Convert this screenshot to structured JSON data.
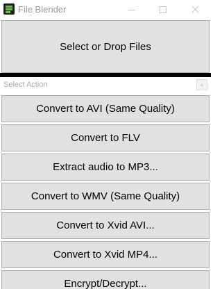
{
  "window": {
    "title": "File Blender",
    "icon": "file-blender-app-icon"
  },
  "drop_zone": {
    "label": "Select or Drop Files"
  },
  "section": {
    "title": "Select Action",
    "collapse_icon": "double-chevron-icon",
    "collapse_glyph": "«"
  },
  "actions": [
    {
      "label": "Convert to AVI (Same Quality)"
    },
    {
      "label": "Convert to FLV"
    },
    {
      "label": "Extract audio to MP3..."
    },
    {
      "label": "Convert to WMV (Same Quality)"
    },
    {
      "label": "Convert to Xvid AVI..."
    },
    {
      "label": "Convert to Xvid MP4..."
    },
    {
      "label": "Encrypt/Decrypt..."
    }
  ],
  "colors": {
    "button_face": "#e1e1e1",
    "button_border": "#adadad",
    "divider": "#000000",
    "icon_accent": "#6ac234"
  }
}
